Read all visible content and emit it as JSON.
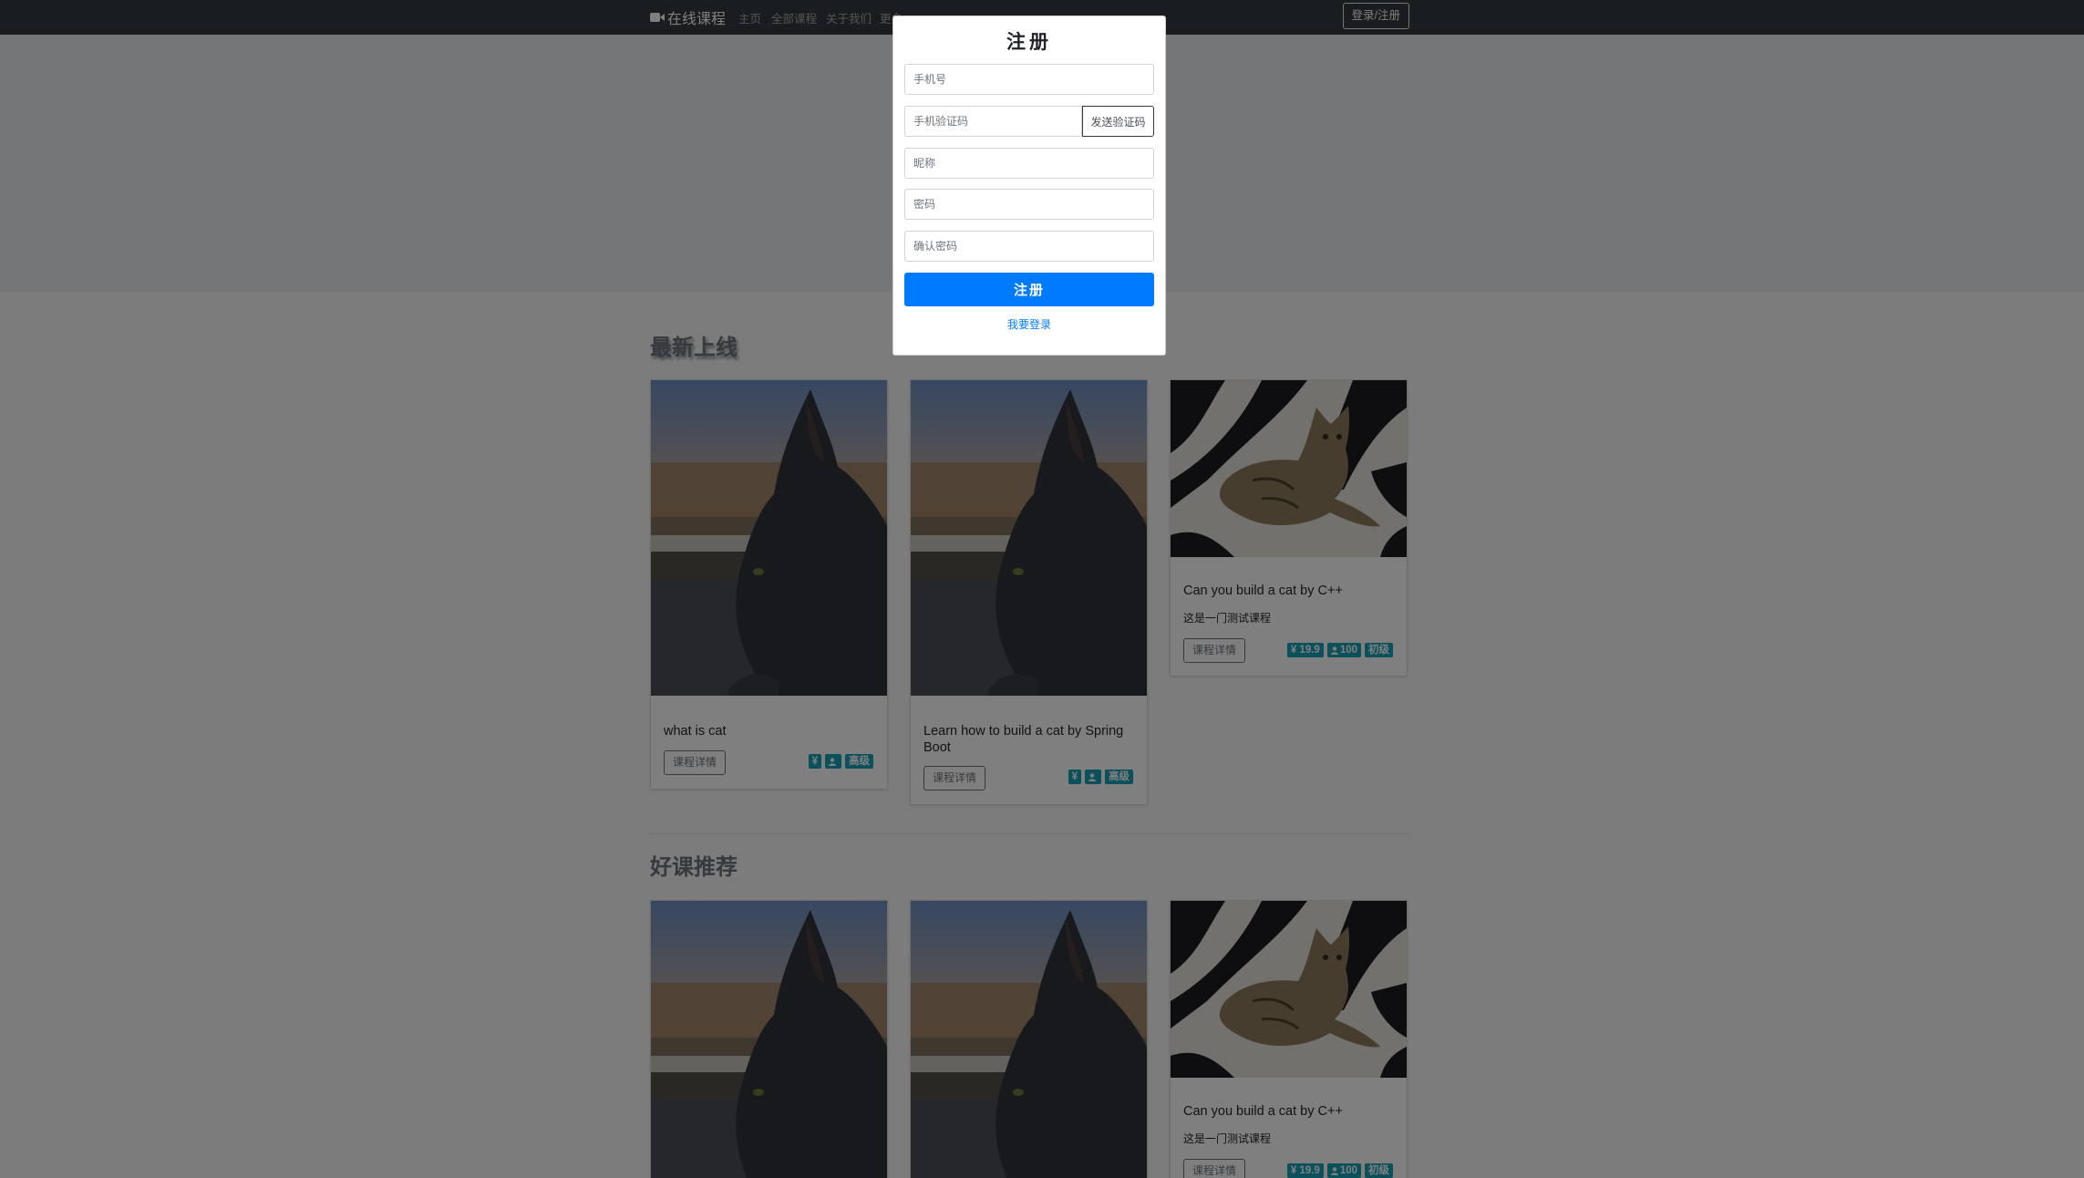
{
  "navbar": {
    "brand": "在线课程",
    "links": [
      "主页",
      "全部课程",
      "关于我们",
      "更多"
    ],
    "login_button": "登录/注册"
  },
  "sections": [
    {
      "title": "最新上线",
      "cards": [
        {
          "image": "cat-window",
          "title": "what is cat",
          "description": "",
          "button": "课程详情",
          "price": "¥",
          "students": "",
          "level": "高级"
        },
        {
          "image": "cat-window",
          "title": "Learn how to build a cat by Spring Boot",
          "description": "",
          "button": "课程详情",
          "price": "¥",
          "students": "",
          "level": "高级"
        },
        {
          "image": "cat-striped-blanket",
          "title": "Can you build a cat by C++",
          "description": "这是一门测试课程",
          "button": "课程详情",
          "price": "¥ 19.9",
          "students": "100",
          "level": "初级"
        }
      ]
    },
    {
      "title": "好课推荐",
      "cards": [
        {
          "image": "cat-window",
          "title": "",
          "description": "",
          "button": "",
          "price": "",
          "students": "",
          "level": ""
        },
        {
          "image": "cat-window",
          "title": "",
          "description": "",
          "button": "",
          "price": "",
          "students": "",
          "level": ""
        },
        {
          "image": "cat-striped-blanket",
          "title": "Can you build a cat by C++",
          "description": "这是一门测试课程",
          "button": "课程详情",
          "price": "¥ 19.9",
          "students": "100",
          "level": "初级"
        }
      ]
    }
  ],
  "modal": {
    "title": "注册",
    "phone_placeholder": "手机号",
    "code_placeholder": "手机验证码",
    "send_code_button": "发送验证码",
    "nickname_placeholder": "昵称",
    "password_placeholder": "密码",
    "confirm_password_placeholder": "确认密码",
    "submit_button": "注册",
    "login_link": "我要登录"
  },
  "colors": {
    "navbar": "#343a40",
    "primary": "#007bff",
    "badge": "#17a2b8"
  }
}
